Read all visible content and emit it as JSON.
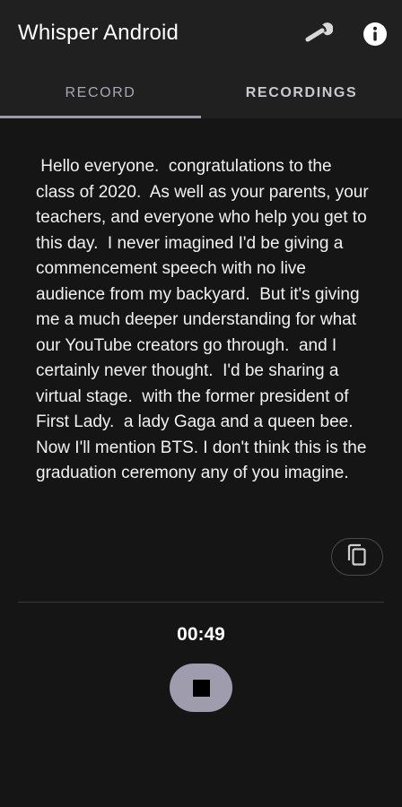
{
  "app": {
    "title": "Whisper Android"
  },
  "toolbar": {
    "settings_icon": "wrench-icon",
    "info_icon": "info-icon"
  },
  "tabs": [
    {
      "label": "RECORD",
      "selected": true
    },
    {
      "label": "RECORDINGS",
      "selected": false
    }
  ],
  "transcript": {
    "text": " Hello everyone.  congratulations to the class of 2020.  As well as your parents, your teachers, and everyone who help you get to this day.  I never imagined I'd be giving a commencement speech with no live audience from my backyard.  But it's giving me a much deeper understanding for what our YouTube creators go through.  and I certainly never thought.  I'd be sharing a virtual stage.  with the former president of First Lady.  a lady Gaga and a queen bee.  Now I'll mention BTS. I don't think this is the graduation ceremony any of you imagine."
  },
  "actions": {
    "copy_icon": "copy-icon"
  },
  "recorder": {
    "elapsed": "00:49",
    "stop_icon": "stop-icon"
  },
  "colors": {
    "background": "#151515",
    "topbar": "#202020",
    "accent": "#9f9cae"
  }
}
